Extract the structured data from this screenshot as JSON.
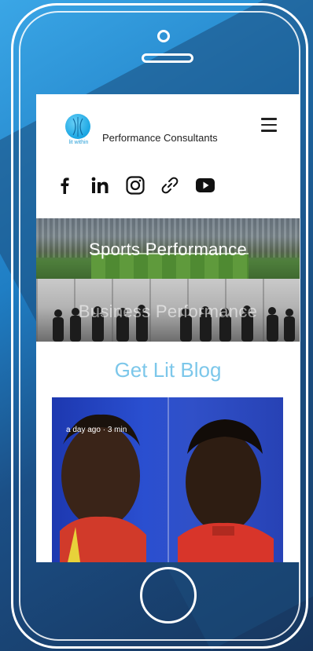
{
  "header": {
    "logo_caption": "lit within",
    "site_title": "Performance Consultants"
  },
  "social": [
    "facebook-icon",
    "linkedin-icon",
    "instagram-icon",
    "link-icon",
    "youtube-icon"
  ],
  "banners": [
    {
      "label": "Sports Performance"
    },
    {
      "label": "Business Performance"
    }
  ],
  "blog": {
    "title": "Get Lit Blog",
    "post_age": "a day ago",
    "post_read": "3 min"
  },
  "colors": {
    "accent": "#7cc7ea",
    "logo": "#1aa6e3"
  }
}
